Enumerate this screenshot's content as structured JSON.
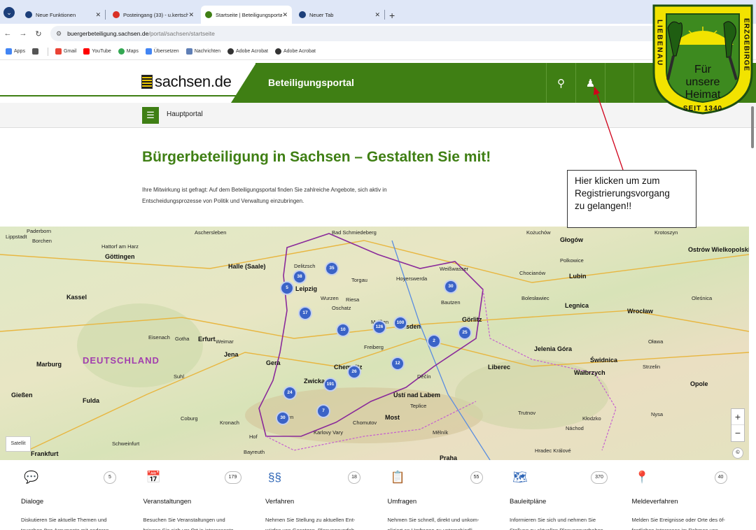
{
  "browser": {
    "tabs": [
      {
        "title": "Neue Funktionen",
        "active": false,
        "color": "#1c3f7a"
      },
      {
        "title": "Posteingang (33) - u.kertscher@",
        "active": false,
        "color": "#d93025"
      },
      {
        "title": "Startseite | Beteiligungsportal S",
        "active": true,
        "color": "#3f7f14"
      },
      {
        "title": "Neuer Tab",
        "active": false,
        "color": "#1c3f7a"
      }
    ],
    "url_domain": "buergerbeteiligung.sachsen.de",
    "url_path": "/portal/sachsen/startseite",
    "bookmarks": [
      "Apps",
      "Gmail",
      "YouTube",
      "Maps",
      "Übersetzen",
      "Nachrichten",
      "Adobe Acrobat",
      "Adobe Acrobat"
    ]
  },
  "header": {
    "logo_text": "sachsen.de",
    "portal_title": "Beteiligungsportal",
    "accent_color": "#3f7f14"
  },
  "subnav": {
    "label": "Hauptportal"
  },
  "main": {
    "headline": "Bürgerbeteiligung in Sachsen – Gestalten Sie mit!",
    "intro_line1": "Ihre Mitwirkung ist gefragt: Auf dem Beteiligungsportal finden Sie zahlreiche Angebote, sich aktiv in",
    "intro_line2": "Entscheidungsprozesse von Politik und Verwaltung einzubringen."
  },
  "callout": {
    "line1": "Hier klicken um zum",
    "line2": "Registrierungsvorgang",
    "line3": "zu gelangen!!"
  },
  "badge": {
    "ring_left": "LIEBENAU",
    "ring_right": "ERZGEBIRGE",
    "ring_bottom": "SEIT 1340",
    "motto_1": "Für",
    "motto_2": "unsere",
    "motto_3": "Heimat"
  },
  "map": {
    "country_label": "DEUTSCHLAND",
    "satellite_label": "Satellit",
    "places": [
      [
        "Paderborn",
        38,
        2,
        false
      ],
      [
        "Lippstadt",
        8,
        10,
        false
      ],
      [
        "Borchen",
        46,
        16,
        false
      ],
      [
        "Hattorf am Harz",
        145,
        24,
        false
      ],
      [
        "Aschersleben",
        278,
        4,
        false
      ],
      [
        "Bad Schmiedeberg",
        474,
        4,
        false
      ],
      [
        "Kożuchów",
        752,
        4,
        false
      ],
      [
        "Krotoszyn",
        935,
        4,
        false
      ],
      [
        "Göttingen",
        150,
        38,
        true
      ],
      [
        "Halle (Saale)",
        326,
        52,
        true
      ],
      [
        "Leipzig",
        422,
        84,
        true
      ],
      [
        "Głogów",
        800,
        14,
        true
      ],
      [
        "Ostrów Wielkopolski",
        983,
        28,
        true
      ],
      [
        "Lubin",
        813,
        66,
        true
      ],
      [
        "Legnica",
        807,
        108,
        true
      ],
      [
        "Wrocław",
        896,
        116,
        true
      ],
      [
        "Kassel",
        95,
        96,
        true
      ],
      [
        "Erfurt",
        283,
        156,
        true
      ],
      [
        "Jena",
        320,
        178,
        true
      ],
      [
        "Gera",
        380,
        190,
        true
      ],
      [
        "Chemnitz",
        477,
        196,
        true
      ],
      [
        "Zwickau",
        434,
        216,
        true
      ],
      [
        "Dresden",
        565,
        138,
        true
      ],
      [
        "Görlitz",
        660,
        128,
        true
      ],
      [
        "Jelenia Góra",
        763,
        170,
        true
      ],
      [
        "Wałbrzych",
        820,
        204,
        true
      ],
      [
        "Świdnica",
        843,
        186,
        true
      ],
      [
        "Opole",
        986,
        220,
        true
      ],
      [
        "Gießen",
        16,
        236,
        true
      ],
      [
        "Fulda",
        118,
        244,
        true
      ],
      [
        "Liberec",
        697,
        196,
        true
      ],
      [
        "Ústí nad Labem",
        562,
        236,
        true
      ],
      [
        "Most",
        550,
        268,
        true
      ],
      [
        "Praha",
        628,
        326,
        true
      ],
      [
        "Frankfurt",
        44,
        320,
        true
      ],
      [
        "Marburg",
        52,
        192,
        true
      ],
      [
        "Bautzen",
        630,
        104,
        false
      ],
      [
        "Riesa",
        494,
        100,
        false
      ],
      [
        "Meißen",
        530,
        132,
        false
      ],
      [
        "Freiberg",
        520,
        168,
        false
      ],
      [
        "Plauen",
        396,
        268,
        false
      ],
      [
        "Hof",
        356,
        296,
        false
      ],
      [
        "Weißwasser",
        628,
        56,
        false
      ],
      [
        "Hoyerswerda",
        566,
        70,
        false
      ],
      [
        "Wurzen",
        458,
        98,
        false
      ],
      [
        "Torgau",
        502,
        72,
        false
      ],
      [
        "Delitzsch",
        420,
        52,
        false
      ],
      [
        "Oschatz",
        474,
        112,
        false
      ],
      [
        "Weimar",
        308,
        160,
        false
      ],
      [
        "Gotha",
        250,
        156,
        false
      ],
      [
        "Eisenach",
        212,
        154,
        false
      ],
      [
        "Suhl",
        248,
        210,
        false
      ],
      [
        "Coburg",
        258,
        270,
        false
      ],
      [
        "Kronach",
        314,
        276,
        false
      ],
      [
        "Schweinfurt",
        160,
        306,
        false
      ],
      [
        "Bayreuth",
        348,
        318,
        false
      ],
      [
        "Karlovy Vary",
        448,
        290,
        false
      ],
      [
        "Chomutov",
        504,
        276,
        false
      ],
      [
        "Teplice",
        586,
        252,
        false
      ],
      [
        "Děčín",
        596,
        210,
        false
      ],
      [
        "Mělník",
        618,
        290,
        false
      ],
      [
        "Hradec Králové",
        764,
        316,
        false
      ],
      [
        "Náchod",
        808,
        284,
        false
      ],
      [
        "Trutnov",
        740,
        262,
        false
      ],
      [
        "Bolesławiec",
        745,
        98,
        false
      ],
      [
        "Polkowice",
        800,
        44,
        false
      ],
      [
        "Chocianów",
        742,
        62,
        false
      ],
      [
        "Oleśnica",
        988,
        98,
        false
      ],
      [
        "Oława",
        926,
        160,
        false
      ],
      [
        "Strzelin",
        918,
        196,
        false
      ],
      [
        "Nysa",
        930,
        264,
        false
      ],
      [
        "Kłodzko",
        832,
        270,
        false
      ]
    ],
    "clusters": [
      [
        "38",
        418,
        62
      ],
      [
        "35",
        464,
        50
      ],
      [
        "5",
        400,
        78
      ],
      [
        "17",
        426,
        114
      ],
      [
        "10",
        480,
        138
      ],
      [
        "126",
        532,
        134
      ],
      [
        "100",
        562,
        128
      ],
      [
        "30",
        634,
        76
      ],
      [
        "25",
        654,
        142
      ],
      [
        "2",
        610,
        154
      ],
      [
        "12",
        558,
        186
      ],
      [
        "26",
        496,
        198
      ],
      [
        "191",
        462,
        216
      ],
      [
        "24",
        404,
        228
      ],
      [
        "30",
        394,
        264
      ],
      [
        "7",
        452,
        254
      ]
    ]
  },
  "categories": [
    {
      "title": "Dialoge",
      "count": "5",
      "icon": "chat-icon",
      "glyph": "💬",
      "desc1": "Diskutieren Sie aktuelle Themen und",
      "desc2": "tauschen Ihre Argumente mit anderen"
    },
    {
      "title": "Veranstaltungen",
      "count": "179",
      "icon": "calendar-icon",
      "glyph": "📅",
      "desc1": "Besuchen Sie Veranstaltungen und",
      "desc2": "bringen Sie sich vor Ort in interessante"
    },
    {
      "title": "Verfahren",
      "count": "18",
      "icon": "paragraph-icon",
      "glyph": "§§",
      "desc1": "Nehmen Sie Stellung zu aktuellen Ent-",
      "desc2": "würfen von Gesetzen, Planungsverfah"
    },
    {
      "title": "Umfragen",
      "count": "55",
      "icon": "clipboard-icon",
      "glyph": "📋",
      "desc1": "Nehmen Sie schnell, direkt und unkom-",
      "desc2": "pliziert an Umfragen zu unterschiedli"
    },
    {
      "title": "Bauleitpläne",
      "count": "370",
      "icon": "map-icon",
      "glyph": "🗺",
      "desc1": "Informieren Sie sich und nehmen Sie",
      "desc2": "Stellung zu aktuellen Planungsvorhaben"
    },
    {
      "title": "Meldeverfahren",
      "count": "40",
      "icon": "location-pin-icon",
      "glyph": "📍",
      "desc1": "Melden Sie Ereignisse oder Orte des öf-",
      "desc2": "fentlichen Interesses im Rahmen von"
    }
  ]
}
